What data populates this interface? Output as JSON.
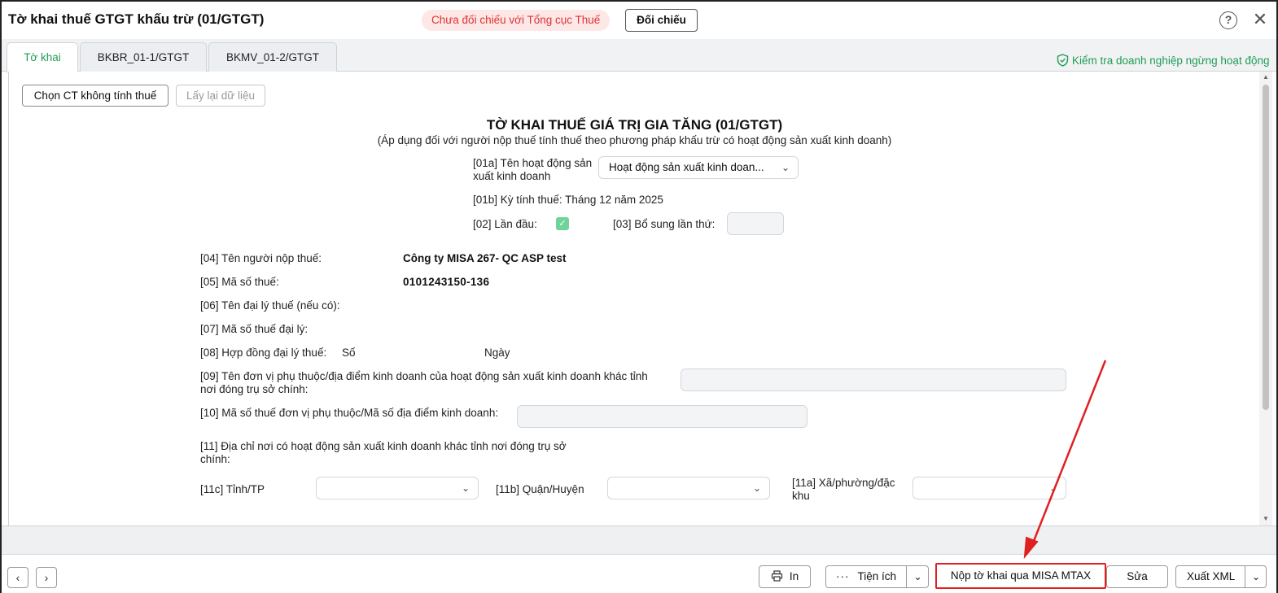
{
  "window": {
    "title": "Tờ khai thuế GTGT khấu trừ (01/GTGT)",
    "status_badge": "Chưa đối chiếu với Tổng cục Thuế",
    "compare_button": "Đối chiếu",
    "help_icon": "question-circle-icon",
    "close_icon": "close-icon"
  },
  "tabs": [
    {
      "label": "Tờ khai",
      "active": true
    },
    {
      "label": "BKBR_01-1/GTGT",
      "active": false
    },
    {
      "label": "BKMV_01-2/GTGT",
      "active": false
    }
  ],
  "check_link": {
    "label": "Kiểm tra doanh nghiệp ngừng hoạt động",
    "icon": "shield-check-icon"
  },
  "toolbar": {
    "choose_button": "Chọn CT không tính thuế",
    "reload_button": "Lấy lại dữ liệu"
  },
  "form": {
    "title": "TỜ KHAI THUẾ GIÁ TRỊ GIA TĂNG (01/GTGT)",
    "subtitle": "(Áp dụng đối với người nộp thuế tính thuế theo phương pháp khấu trừ có hoạt động sản xuất kinh doanh)",
    "f01a_label_line1": "[01a] Tên hoạt động sản",
    "f01a_label_line2": "xuất kinh doanh",
    "f01a_value": "Hoạt động sản xuất kinh doan...",
    "f01b": "[01b] Kỳ tính thuế: Tháng 12 năm 2025",
    "f02_label": "[02] Lần đầu:",
    "f02_checked": true,
    "f03_label": "[03] Bổ sung lần thứ:",
    "f03_value": "",
    "f04_label": "[04] Tên người nộp thuế:",
    "f04_value": "Công ty MISA 267- QC ASP test",
    "f05_label": "[05] Mã số thuế:",
    "f05_value": "0101243150-136",
    "f06_label": "[06] Tên đại lý thuế (nếu có):",
    "f07_label": "[07] Mã số thuế đại lý:",
    "f08_label": "[08] Hợp đồng đại lý thuế:",
    "f08_so": "Số",
    "f08_ngay": "Ngày",
    "f09_label_line1": "[09] Tên đơn vị phụ thuộc/địa điểm kinh doanh của hoạt động sản xuất kinh doanh khác tỉnh",
    "f09_label_line2": "nơi đóng trụ sở chính:",
    "f09_value": "",
    "f10_label": "[10] Mã số thuế đơn vị phụ thuộc/Mã số địa điểm kinh doanh:",
    "f10_value": "",
    "f11_label_line1": "[11] Địa chỉ nơi có hoạt động sản xuất kinh doanh khác tỉnh nơi đóng trụ sở",
    "f11_label_line2": "chính:",
    "f11c_label": "[11c] Tỉnh/TP",
    "f11b_label": "[11b] Quận/Huyện",
    "f11a_label_line1": "[11a] Xã/phường/đặc",
    "f11a_label_line2": "khu"
  },
  "bottom": {
    "prev_icon": "chevron-left-icon",
    "next_icon": "chevron-right-icon",
    "print_button": "In",
    "print_icon": "printer-icon",
    "utility_button": "Tiện ích",
    "utility_icon": "more-horizontal-icon",
    "submit_button": "Nộp tờ khai qua MISA MTAX",
    "edit_button": "Sửa",
    "export_button": "Xuất XML"
  },
  "colors": {
    "accent_green": "#1f9d55",
    "alert_red": "#e03131",
    "annotation_red": "#e02020"
  }
}
